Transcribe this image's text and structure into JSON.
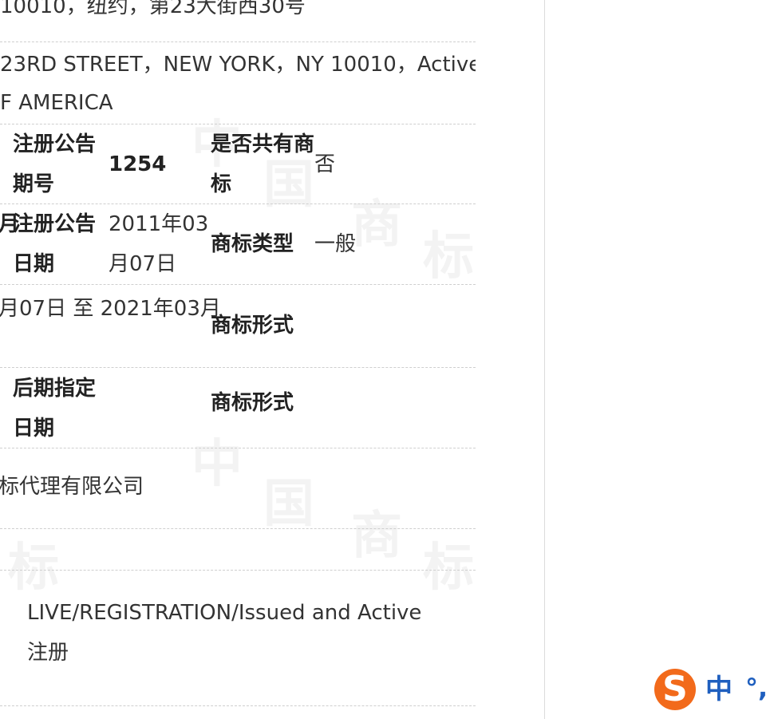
{
  "address": {
    "cn_partial": "10010，纽约，第23大街西30号",
    "en_line1": "23RD STREET，NEW YORK，NY 10010，Active",
    "en_line2": "F AMERICA"
  },
  "row_pub": {
    "label_l1": "注册公告",
    "label_l2": "期号",
    "value": "1254",
    "shared_label_l1": "是否共有商",
    "shared_label_l2": "标",
    "shared_value": "否"
  },
  "row_date": {
    "prefix": "月",
    "label_l1": "注册公告",
    "label_l2": "日期",
    "value_l1": "2011年03",
    "value_l2": "月07日",
    "type_label": "商标类型",
    "type_value": "一般"
  },
  "row_validity": {
    "period": "月07日 至 2021年03月",
    "form_label": "商标形式"
  },
  "row_later": {
    "label_l1": "后期指定",
    "label_l2": "日期",
    "form_label": "商标形式"
  },
  "agent": {
    "name": "标代理有限公司"
  },
  "status": {
    "line1": "LIVE/REGISTRATION/Issued and Active",
    "line2": "注册"
  },
  "footer_partial": "...",
  "watermark": [
    "中",
    "国",
    "商",
    "标"
  ],
  "ime": {
    "logo": "S",
    "lang": "中",
    "punct": "°,"
  }
}
